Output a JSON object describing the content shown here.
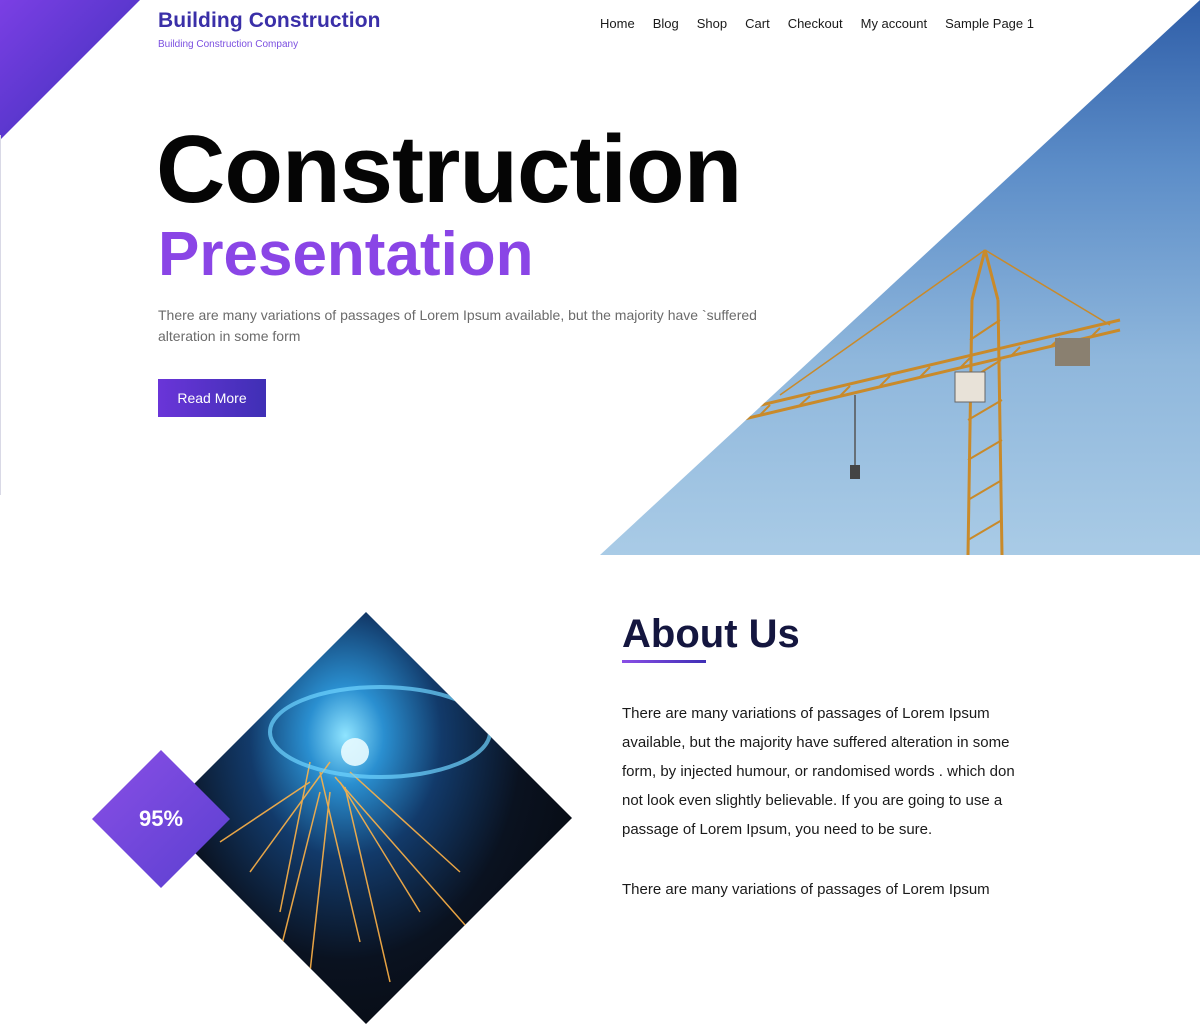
{
  "header": {
    "site_title": "Building Construction",
    "tagline": "Building Construction Company"
  },
  "nav": {
    "items": [
      {
        "label": "Home"
      },
      {
        "label": "Blog"
      },
      {
        "label": "Shop"
      },
      {
        "label": "Cart"
      },
      {
        "label": "Checkout"
      },
      {
        "label": "My account"
      },
      {
        "label": "Sample Page 1"
      }
    ]
  },
  "hero": {
    "title_line1": "Construction",
    "title_line2": "Presentation",
    "description": "There are many variations of passages of Lorem Ipsum available, but the majority have `suffered alteration in some form",
    "button_label": "Read More"
  },
  "about": {
    "title": "About Us",
    "badge_value": "95%",
    "paragraph1": "There are many variations of passages of Lorem Ipsum available, but the majority have suffered alteration in some form, by injected humour, or randomised words . which don not look even slightly believable. If you are going to use a passage of Lorem Ipsum, you need to be sure.",
    "paragraph2": "There are many variations of passages of Lorem Ipsum"
  },
  "colors": {
    "brand": "#3a2fa8",
    "accent": "#8a45e6",
    "heading_dark": "#14163f"
  }
}
